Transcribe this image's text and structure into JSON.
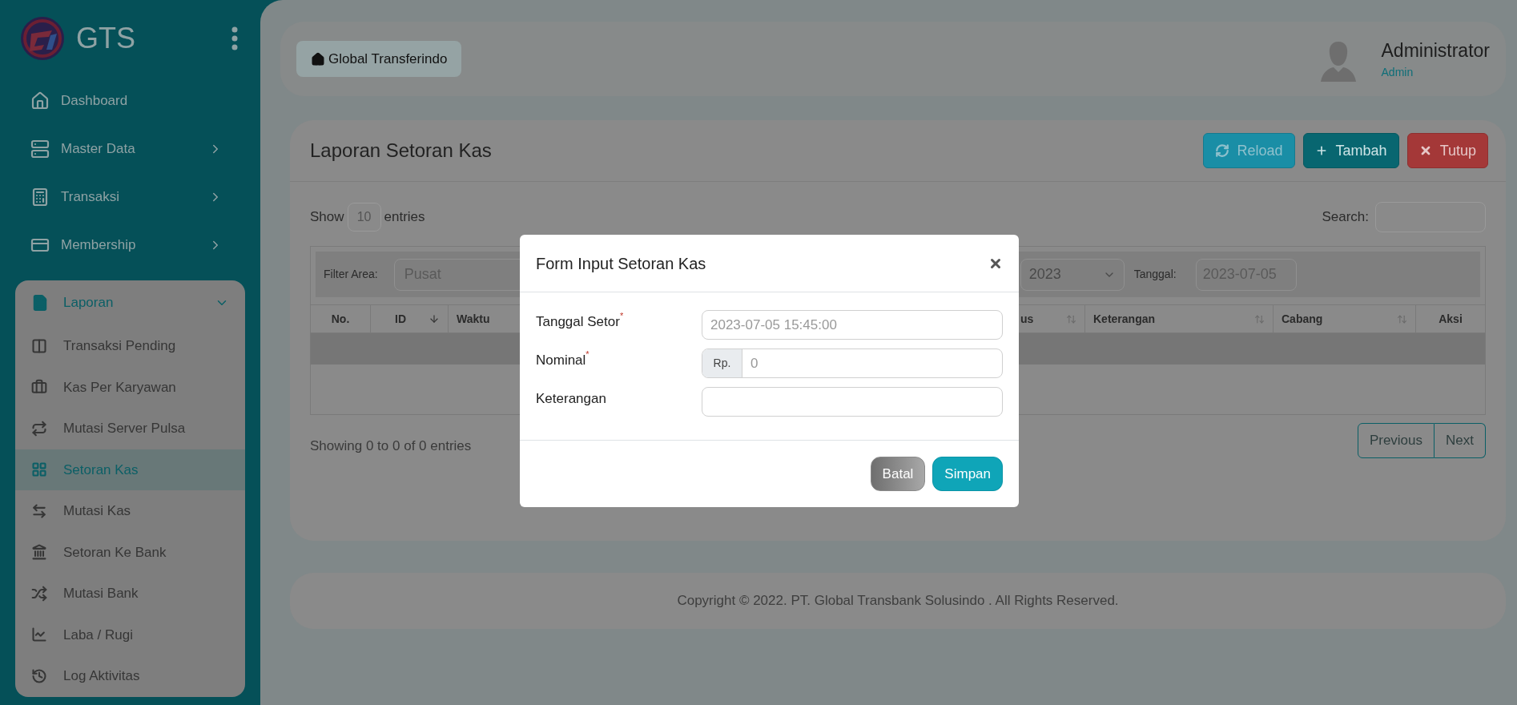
{
  "sidebar": {
    "brand": "GTS",
    "items": [
      {
        "label": "Dashboard",
        "selected": false
      },
      {
        "label": "Master Data",
        "selected": false,
        "expanded": false
      },
      {
        "label": "Transaksi",
        "selected": false,
        "expanded": false
      },
      {
        "label": "Membership",
        "selected": false,
        "expanded": false
      },
      {
        "label": "Laporan",
        "selected": false,
        "expanded": true,
        "children": [
          {
            "label": "Transaksi Pending",
            "selected": false
          },
          {
            "label": "Kas Per Karyawan",
            "selected": false
          },
          {
            "label": "Mutasi Server Pulsa",
            "selected": false
          },
          {
            "label": "Setoran Kas",
            "selected": true
          },
          {
            "label": "Mutasi Kas",
            "selected": false
          },
          {
            "label": "Setoran Ke Bank",
            "selected": false
          },
          {
            "label": "Mutasi Bank",
            "selected": false
          },
          {
            "label": "Laba / Rugi",
            "selected": false
          },
          {
            "label": "Log Aktivitas",
            "selected": false
          }
        ]
      }
    ]
  },
  "header": {
    "breadcrumb": "Global Transferindo",
    "user": {
      "name": "Administrator",
      "role": "Admin"
    }
  },
  "card": {
    "title": "Laporan Setoran Kas",
    "buttons": [
      {
        "label": "Reload",
        "kind": "reload"
      },
      {
        "label": "Tambah",
        "kind": "add"
      },
      {
        "label": "Tutup",
        "kind": "close"
      }
    ],
    "show_label": "Show",
    "entries_value": "10",
    "entries_label": "entries",
    "search_label": "Search:",
    "filter": {
      "area_label": "Filter Area:",
      "area_value": "Pusat",
      "year_value": "2023",
      "date_label": "Tanggal:",
      "date_value": "2023-07-05"
    },
    "columns": [
      {
        "label": "No."
      },
      {
        "label": "ID",
        "sorted": true
      },
      {
        "label": "Waktu"
      },
      {
        "label": "us",
        "sorted": false
      },
      {
        "label": "Keterangan",
        "sorted": false
      },
      {
        "label": "Cabang",
        "sorted": false
      },
      {
        "label": "Aksi"
      }
    ],
    "info": "Showing 0 to 0 of 0 entries",
    "pagination": [
      "Previous",
      "Next"
    ]
  },
  "footer": "Copyright © 2022. PT. Global Transbank Solusindo . All Rights Reserved.",
  "modal": {
    "title": "Form Input Setoran Kas",
    "fields": [
      {
        "label": "Tanggal Setor",
        "required_mark": "*",
        "placeholder": "2023-07-05 15:45:00"
      },
      {
        "label": "Nominal",
        "required_mark": "*",
        "prefix": "Rp.",
        "placeholder": "0"
      },
      {
        "label": "Keterangan"
      }
    ],
    "buttons": [
      {
        "label": "Batal",
        "kind": "cancel"
      },
      {
        "label": "Simpan",
        "kind": "save"
      }
    ]
  }
}
